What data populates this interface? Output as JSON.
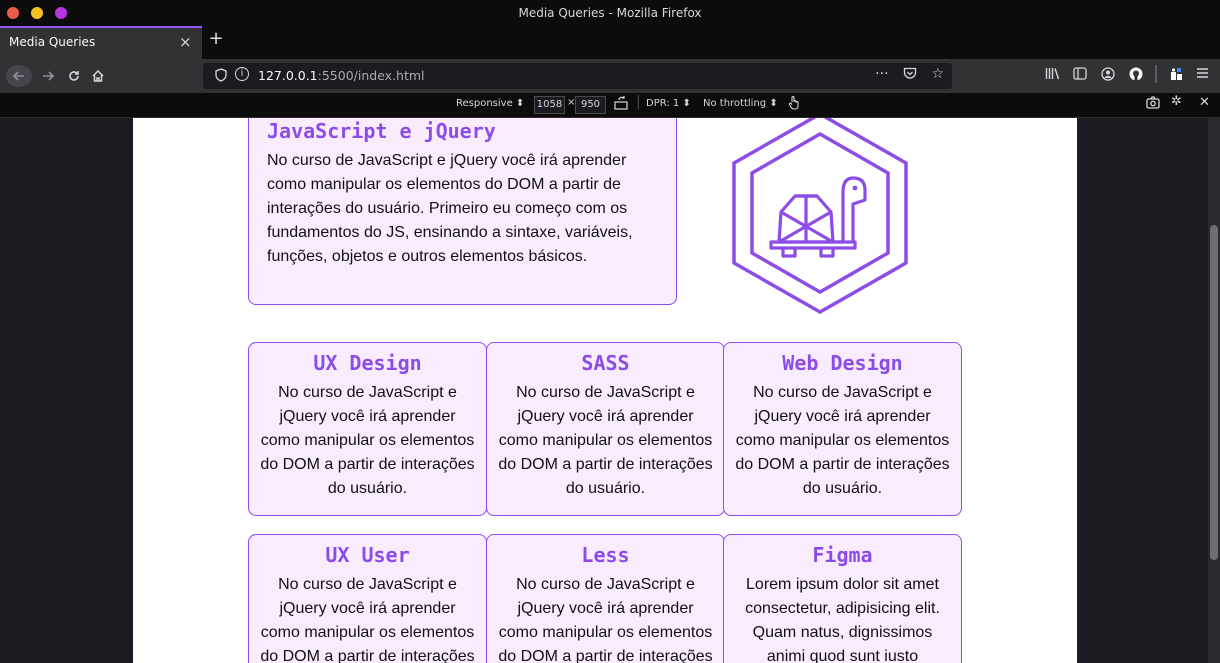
{
  "window": {
    "title": "Media Queries - Mozilla Firefox"
  },
  "tab": {
    "label": "Media Queries",
    "close_glyph": "×",
    "new_tab_glyph": "+"
  },
  "nav": {
    "url_host": "127.0.0.1",
    "url_rest": ":5500/index.html",
    "page_actions_glyph": "···"
  },
  "rdm": {
    "device": "Responsive",
    "width": "1058",
    "times": "×",
    "height": "950",
    "dpr": "DPR: 1",
    "throttling": "No throttling"
  },
  "page": {
    "hero": {
      "title": "JavaScript e jQuery",
      "text": "No curso de JavaScript e jQuery você irá aprender como manipular os elementos do DOM a partir de interações do usuário. Primeiro eu começo com os fundamentos do JS, ensinando a sintaxe, variáveis, funções, objetos e outros elementos básicos."
    },
    "cards": [
      {
        "title": "UX Design",
        "text": "No curso de JavaScript e jQuery você irá aprender como manipular os elementos do DOM a partir de interações do usuário."
      },
      {
        "title": "SASS",
        "text": "No curso de JavaScript e jQuery você irá aprender como manipular os elementos do DOM a partir de interações do usuário."
      },
      {
        "title": "Web Design",
        "text": "No curso de JavaScript e jQuery você irá aprender como manipular os elementos do DOM a partir de interações do usuário."
      },
      {
        "title": "UX User",
        "text": "No curso de JavaScript e jQuery você irá aprender como manipular os elementos do DOM a partir de interações do usuário."
      },
      {
        "title": "Less",
        "text": "No curso de JavaScript e jQuery você irá aprender como manipular os elementos do DOM a partir de interações do usuário."
      },
      {
        "title": "Figma",
        "text": "Lorem ipsum dolor sit amet consectetur, adipisicing elit. Quam natus, dignissimos animi quod sunt iusto"
      }
    ]
  },
  "colors": {
    "accent": "#8d4ce8",
    "card_bg": "#f8ecfd"
  },
  "icons": [
    "shield-icon",
    "info-icon",
    "bookmark-star-icon",
    "pocket-icon",
    "library-icon",
    "sidebar-icon",
    "account-icon",
    "github-icon",
    "extensions-icon",
    "menu-icon",
    "screenshot-icon",
    "settings-icon",
    "close-icon",
    "rotate-icon",
    "touch-icon",
    "turtle-hexagon-logo"
  ]
}
